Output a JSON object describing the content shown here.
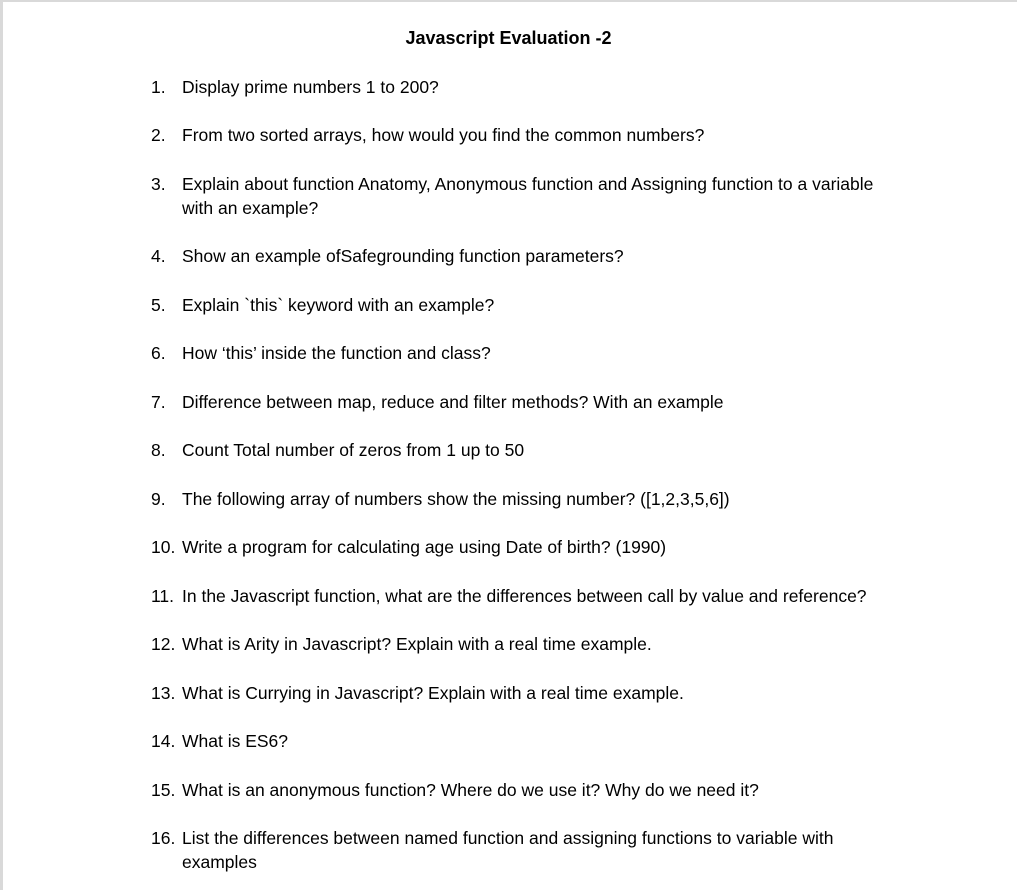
{
  "document": {
    "title": "Javascript Evaluation -2",
    "questions": [
      {
        "num": "1.",
        "text": "Display prime numbers 1 to 200?"
      },
      {
        "num": "2.",
        "text": "From two sorted arrays, how would you find the common numbers?"
      },
      {
        "num": "3.",
        "text": "Explain about function Anatomy, Anonymous function  and Assigning function to a variable with an example?"
      },
      {
        "num": "4.",
        "text": "Show an example ofSafegrounding function parameters?"
      },
      {
        "num": "5.",
        "text": "Explain `this` keyword with an example?"
      },
      {
        "num": "6.",
        "text": "How ‘this’ inside the function and class?"
      },
      {
        "num": "7.",
        "text": "Difference between map, reduce and filter methods? With an example"
      },
      {
        "num": "8.",
        "text": "Count Total number of zeros from 1 up to 50"
      },
      {
        "num": "9.",
        "text": "The following array of numbers show the missing number? ([1,2,3,5,6])"
      },
      {
        "num": "10.",
        "text": "Write a program for calculating age using Date of birth? (1990)"
      },
      {
        "num": "11.",
        "text": "In the Javascript function, what are the differences between call by value and reference?"
      },
      {
        "num": "12.",
        "text": "What is Arity in Javascript? Explain with a real time example."
      },
      {
        "num": "13.",
        "text": "What is Currying in Javascript? Explain with a real time example."
      },
      {
        "num": "14.",
        "text": "What is ES6?"
      },
      {
        "num": "15.",
        "text": "What is an anonymous function? Where do we use it? Why do we need it?"
      },
      {
        "num": "16.",
        "text": "List the differences between named function and assigning functions to variable with examples"
      }
    ]
  }
}
